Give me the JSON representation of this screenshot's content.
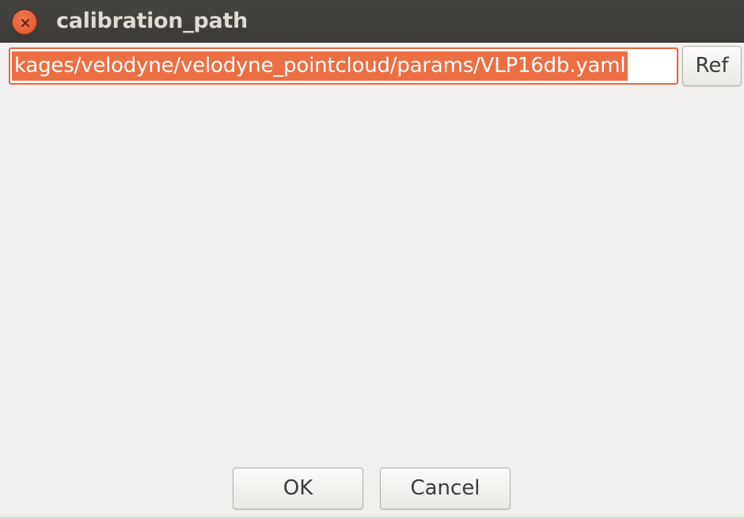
{
  "window": {
    "title": "calibration_path"
  },
  "path_field": {
    "value": "kages/velodyne/velodyne_pointcloud/params/VLP16db.yaml"
  },
  "buttons": {
    "ref_label": "Ref",
    "ok_label": "OK",
    "cancel_label": "Cancel"
  },
  "icons": {
    "close": "close-icon"
  },
  "colors": {
    "titlebar": "#3f3e3a",
    "close_button": "#e5572c",
    "selection": "#ec6f44",
    "focus_border": "#e2693f",
    "window_bg": "#f1f0ee"
  }
}
